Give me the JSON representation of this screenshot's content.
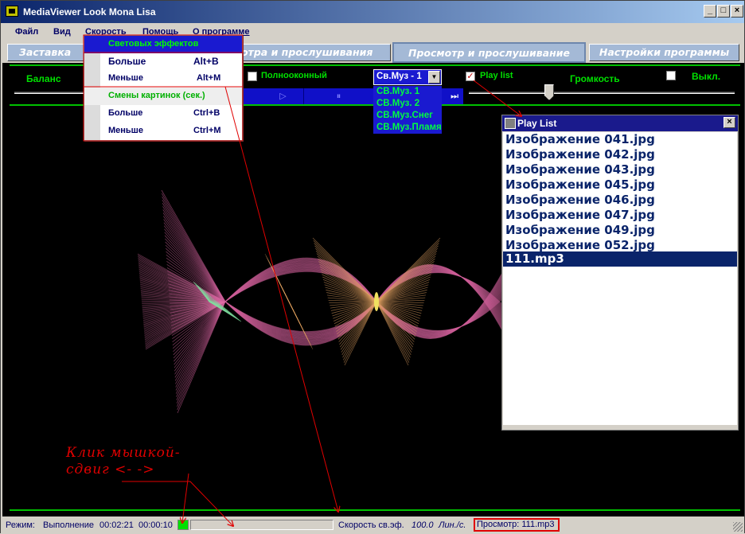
{
  "window": {
    "title": "MediaViewer Look Mona Lisa"
  },
  "menubar": [
    "Файл",
    "Вид",
    "Скорость",
    "Помощь",
    "О программе"
  ],
  "tabs": [
    "Заставка пр",
    "отра и прослушивания",
    "Просмотр и прослушивание",
    "Настройки программы"
  ],
  "controls": {
    "balance": "Баланс",
    "fullscreen": "Полнооконный",
    "effect_combo": "Св.Муз - 1",
    "effect_options": [
      "СВ.Муз. 1",
      "СВ.Муз. 2",
      "СВ.Муз.Снег",
      "СВ.Муз.Пламя"
    ],
    "playlist_check": "Play list",
    "volume": "Громкость",
    "off": "Выкл.",
    "play_glyph": "▷",
    "pause_glyph": "⏸",
    "end_glyph": "⏭"
  },
  "speed_menu": {
    "header1": "Световых эффектов",
    "more1": "Больше",
    "more1_sc": "Alt+B",
    "less1": "Меньше",
    "less1_sc": "Alt+M",
    "header2": "Смены картинок (сек.)",
    "more2": "Больше",
    "more2_sc": "Ctrl+B",
    "less2": "Меньше",
    "less2_sc": "Ctrl+M"
  },
  "playlist": {
    "title": "Play List",
    "items": [
      "Изображение 041.jpg",
      "Изображение 042.jpg",
      "Изображение 043.jpg",
      "Изображение 045.jpg",
      "Изображение 046.jpg",
      "Изображение 047.jpg",
      "Изображение 049.jpg",
      "Изображение 052.jpg",
      "111.mp3"
    ],
    "selected": "111.mp3"
  },
  "status": {
    "mode_label": "Режим:",
    "mode": "Выполнение",
    "elapsed": "00:02:21",
    "interval": "00:00:10",
    "speed_label": "Скорость св.эф.",
    "speed_value": "100.0",
    "speed_unit": "Лин./с.",
    "view": "Просмотр: 111.mp3"
  },
  "annotation": {
    "line1": "Клик мышкой-",
    "line2": "сдвиг <-  ->"
  },
  "colors": {
    "accent_green": "#00e000",
    "stage": "#000000",
    "select_blue": "#0a246a",
    "annot_red": "#e00000"
  }
}
